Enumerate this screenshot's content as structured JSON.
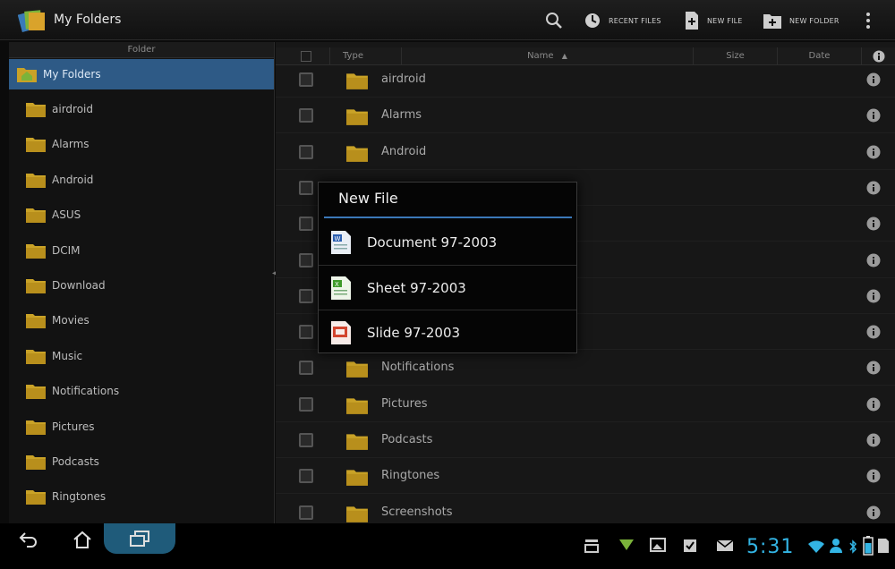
{
  "app": {
    "title": "My Folders"
  },
  "toolbar": {
    "recent_files_label": "RECENT FILES",
    "new_file_label": "NEW FILE",
    "new_folder_label": "NEW FOLDER"
  },
  "left_panel": {
    "header": "Folder",
    "root": "My Folders",
    "items": [
      "airdroid",
      "Alarms",
      "Android",
      "ASUS",
      "DCIM",
      "Download",
      "Movies",
      "Music",
      "Notifications",
      "Pictures",
      "Podcasts",
      "Ringtones"
    ]
  },
  "file_list": {
    "columns": {
      "type": "Type",
      "name": "Name",
      "size": "Size",
      "date": "Date"
    },
    "rows": [
      "airdroid",
      "Alarms",
      "Android",
      "",
      "",
      "",
      "",
      "",
      "Notifications",
      "Pictures",
      "Podcasts",
      "Ringtones",
      "Screenshots"
    ]
  },
  "dialog": {
    "title": "New File",
    "items": [
      "Document 97-2003",
      "Sheet 97-2003",
      "Slide 97-2003"
    ]
  },
  "status": {
    "time": "5:31"
  },
  "colors": {
    "accent": "#33b5e5",
    "selection": "#2e5a86",
    "folder": "#c9a227"
  }
}
